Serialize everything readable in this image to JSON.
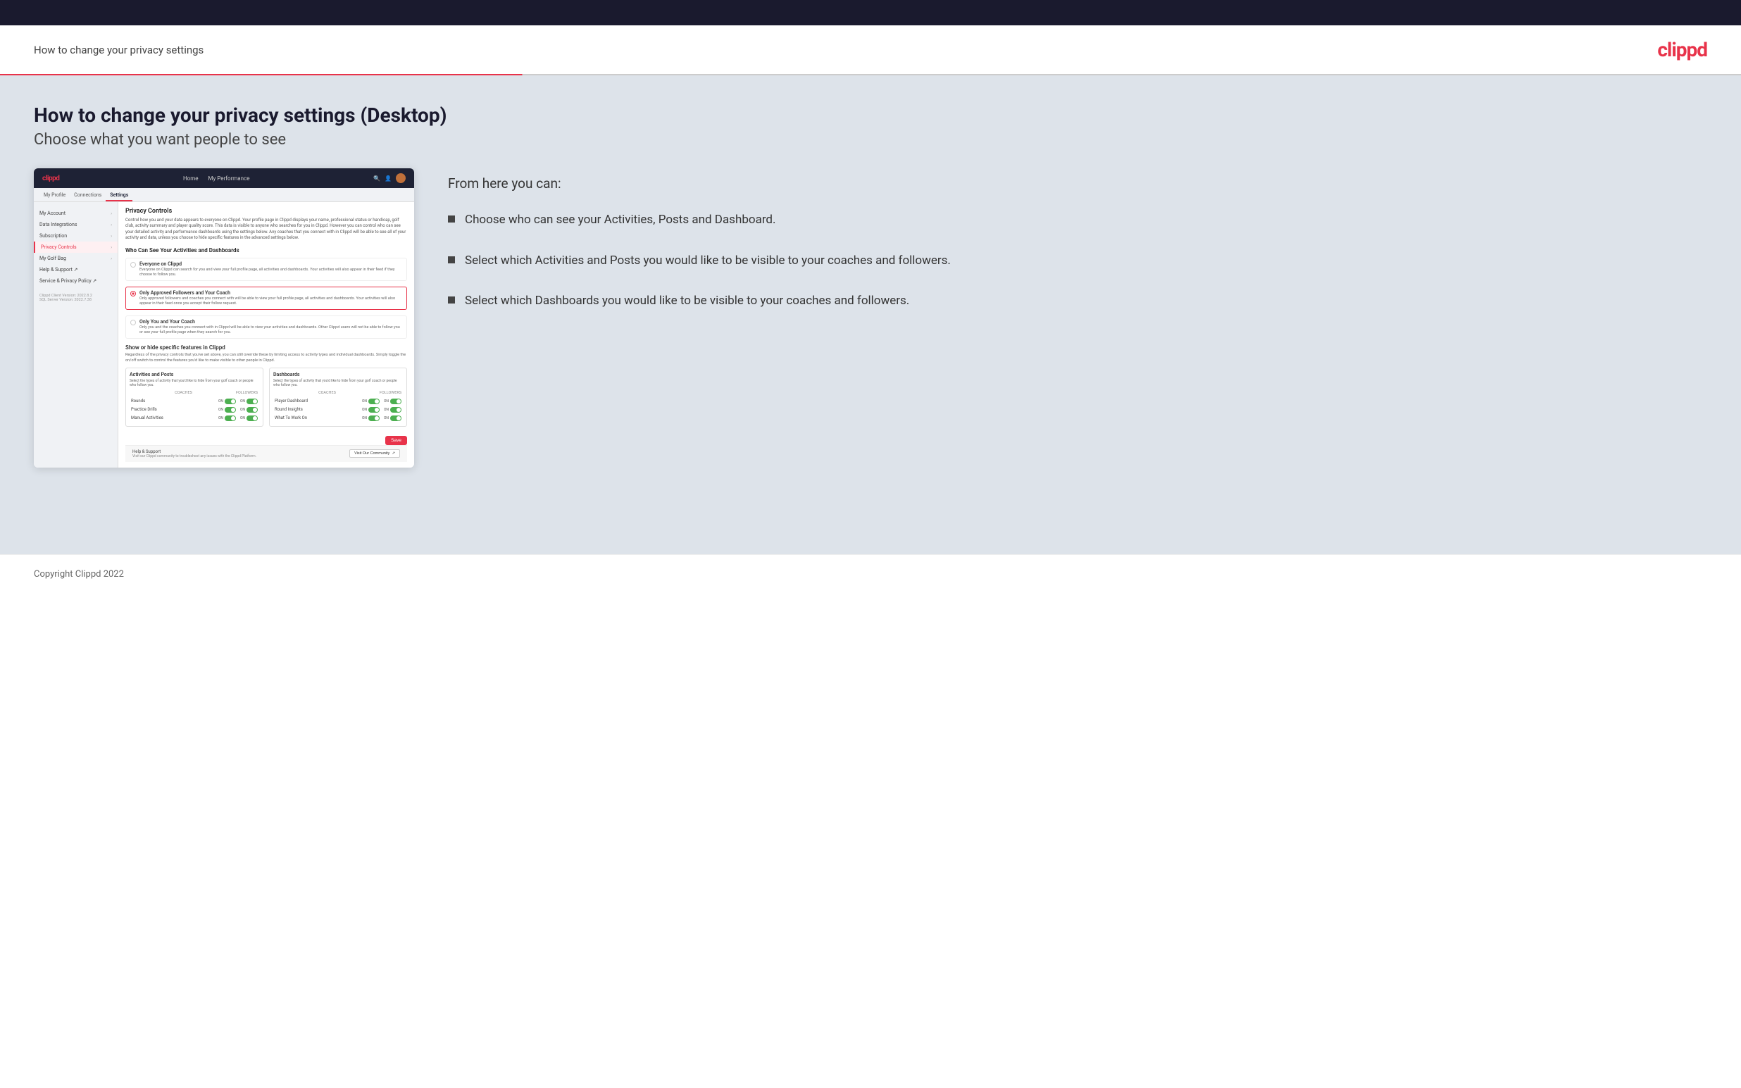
{
  "header": {
    "title": "How to change your privacy settings",
    "logo": "clippd"
  },
  "page": {
    "heading": "How to change your privacy settings (Desktop)",
    "subheading": "Choose what you want people to see"
  },
  "right_panel": {
    "from_here_label": "From here you can:",
    "bullets": [
      "Choose who can see your Activities, Posts and Dashboard.",
      "Select which Activities and Posts you would like to be visible to your coaches and followers.",
      "Select which Dashboards you would like to be visible to your coaches and followers."
    ]
  },
  "mock_ui": {
    "navbar": {
      "logo": "clippd",
      "links": [
        "Home",
        "My Performance"
      ]
    },
    "sub_nav": [
      "My Profile",
      "Connections",
      "Settings"
    ],
    "sub_nav_active": "Settings",
    "sidebar_items": [
      {
        "label": "My Account",
        "active": false
      },
      {
        "label": "Data Integrations",
        "active": false
      },
      {
        "label": "Subscription",
        "active": false
      },
      {
        "label": "Privacy Controls",
        "active": true
      },
      {
        "label": "My Golf Bag",
        "active": false
      },
      {
        "label": "Help & Support ↗",
        "active": false
      },
      {
        "label": "Service & Privacy Policy ↗",
        "active": false
      }
    ],
    "version": "Clippd Client Version: 2022.8.2\nSQL Server Version: 2022.7.38",
    "section_title": "Privacy Controls",
    "section_desc": "Control how you and your data appears to everyone on Clippd. Your profile page in Clippd displays your name, professional status or handicap, golf club, activity summary and player quality score. This data is visible to anyone who searches for you in Clippd. However you can control who can see your detailed activity and performance dashboards using the settings below. Any coaches that you connect with in Clippd will be able to see all of your activity and data, unless you choose to hide specific features in the advanced settings below.",
    "who_can_see_title": "Who Can See Your Activities and Dashboards",
    "radio_options": [
      {
        "label": "Everyone on Clippd",
        "desc": "Everyone on Clippd can search for you and view your full profile page, all activities and dashboards. Your activities will also appear in their feed if they choose to follow you.",
        "selected": false
      },
      {
        "label": "Only Approved Followers and Your Coach",
        "desc": "Only approved followers and coaches you connect with will be able to view your full profile page, all activities and dashboards. Your activities will also appear in their feed once you accept their follow request.",
        "selected": true
      },
      {
        "label": "Only You and Your Coach",
        "desc": "Only you and the coaches you connect with in Clippd will be able to view your activities and dashboards. Other Clippd users will not be able to follow you or see your full profile page when they search for you.",
        "selected": false
      }
    ],
    "show_hide_title": "Show or hide specific features in Clippd",
    "show_hide_desc": "Regardless of the privacy controls that you've set above, you can still override these by limiting access to activity types and individual dashboards. Simply toggle the on/off switch to control the features you'd like to make visible to other people in Clippd.",
    "activities_panel": {
      "title": "Activities and Posts",
      "desc": "Select the types of activity that you'd like to hide from your golf coach or people who follow you.",
      "headers": [
        "COACHES",
        "FOLLOWERS"
      ],
      "rows": [
        {
          "label": "Rounds",
          "coaches": "ON",
          "followers": "ON"
        },
        {
          "label": "Practice Drills",
          "coaches": "ON",
          "followers": "ON"
        },
        {
          "label": "Manual Activities",
          "coaches": "ON",
          "followers": "ON"
        }
      ]
    },
    "dashboards_panel": {
      "title": "Dashboards",
      "desc": "Select the types of activity that you'd like to hide from your golf coach or people who follow you.",
      "headers": [
        "COACHES",
        "FOLLOWERS"
      ],
      "rows": [
        {
          "label": "Player Dashboard",
          "coaches": "ON",
          "followers": "ON"
        },
        {
          "label": "Round Insights",
          "coaches": "ON",
          "followers": "ON"
        },
        {
          "label": "What To Work On",
          "coaches": "ON",
          "followers": "ON"
        }
      ]
    },
    "save_label": "Save",
    "help_section": {
      "title": "Help & Support",
      "desc": "Visit our Clippd community to troubleshoot any issues with the Clippd Platform.",
      "button": "Visit Our Community ↗"
    }
  },
  "footer": {
    "copyright": "Copyright Clippd 2022"
  }
}
